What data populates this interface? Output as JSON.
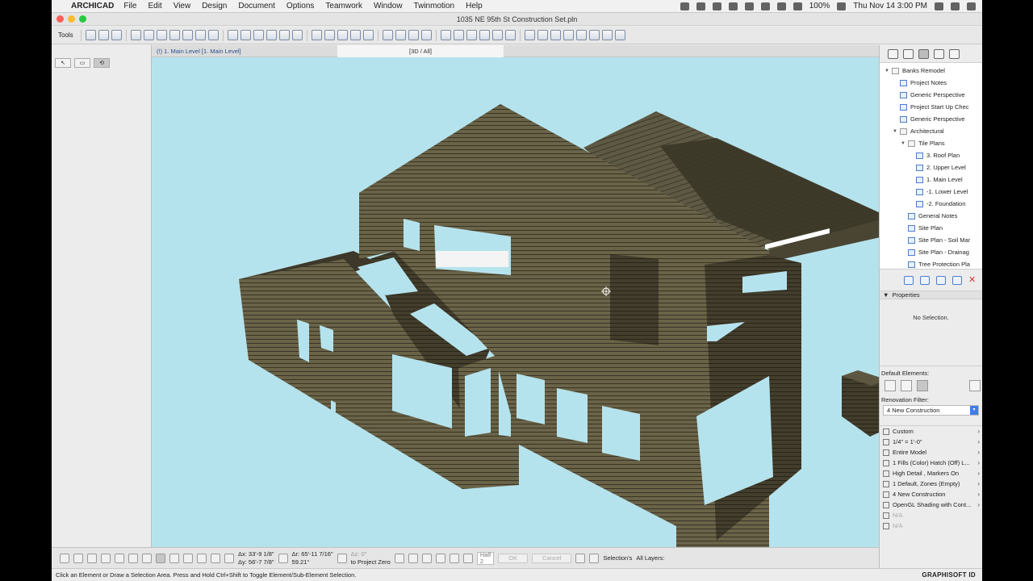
{
  "menubar": {
    "app_name": "ARCHICAD",
    "items": [
      "File",
      "Edit",
      "View",
      "Design",
      "Document",
      "Options",
      "Teamwork",
      "Window",
      "Twinmotion",
      "Help"
    ],
    "battery": "100%",
    "clock": "Thu Nov 14  3:00 PM"
  },
  "window": {
    "title": "1035 NE 95th St Construction Set.pln"
  },
  "toolbar": {
    "tools_label": "Tools"
  },
  "tabs": [
    {
      "label": "(!) 1. Main Level [1. Main Level]"
    },
    {
      "label": "[3D / All]"
    }
  ],
  "navigator": {
    "items": [
      {
        "label": "Banks Remodel",
        "level": 0,
        "disclosure": "▼",
        "folder": true
      },
      {
        "label": "Project Notes",
        "level": 1,
        "disclosure": "",
        "folder": false
      },
      {
        "label": "Generic Perspective",
        "level": 1,
        "disclosure": "",
        "folder": false
      },
      {
        "label": "Project Start Up Chec",
        "level": 1,
        "disclosure": "",
        "folder": false
      },
      {
        "label": "Generic Perspective",
        "level": 1,
        "disclosure": "",
        "folder": false
      },
      {
        "label": "Architectural",
        "level": 1,
        "disclosure": "▼",
        "folder": true
      },
      {
        "label": "Tile Plans",
        "level": 2,
        "disclosure": "▼",
        "folder": true
      },
      {
        "label": "3. Roof Plan",
        "level": 3,
        "disclosure": "",
        "folder": false
      },
      {
        "label": "2. Upper Level",
        "level": 3,
        "disclosure": "",
        "folder": false
      },
      {
        "label": "1. Main Level",
        "level": 3,
        "disclosure": "",
        "folder": false
      },
      {
        "label": "-1. Lower Level",
        "level": 3,
        "disclosure": "",
        "folder": false
      },
      {
        "label": "-2. Foundation",
        "level": 3,
        "disclosure": "",
        "folder": false
      },
      {
        "label": "General Notes",
        "level": 2,
        "disclosure": "",
        "folder": false
      },
      {
        "label": "Site Plan",
        "level": 2,
        "disclosure": "",
        "folder": false
      },
      {
        "label": "Site Plan - Soil Mar",
        "level": 2,
        "disclosure": "",
        "folder": false
      },
      {
        "label": "Site Plan - Drainag",
        "level": 2,
        "disclosure": "",
        "folder": false
      },
      {
        "label": "Tree Protection Pla",
        "level": 2,
        "disclosure": "",
        "folder": false
      }
    ]
  },
  "properties": {
    "header": "Properties",
    "empty_text": "No Selection."
  },
  "defaults": {
    "label": "Default Elements:",
    "renovation_label": "Renovation Filter:",
    "renovation_value": "4 New Construction"
  },
  "quick_options": [
    {
      "label": "Custom",
      "muted": false
    },
    {
      "label": "1/4\"   =    1'-0\"",
      "muted": false
    },
    {
      "label": "Entire Model",
      "muted": false
    },
    {
      "label": "1 Fills (Color) Hatch (Off) L...",
      "muted": false
    },
    {
      "label": "High Detail , Markers On",
      "muted": false
    },
    {
      "label": "1 Default, Zones (Empty)",
      "muted": false
    },
    {
      "label": "4 New Construction",
      "muted": false
    },
    {
      "label": "OpenGL Shading with Cont...",
      "muted": false
    },
    {
      "label": "N/A",
      "muted": true
    },
    {
      "label": "N/A",
      "muted": true
    }
  ],
  "infobar": {
    "dx": "Δx: 33'-9 1/8\"",
    "dy": "Δy: 56'-7 7/8\"",
    "dr": "Δr: 65'-11 7/16\"",
    "angle": "59.21°",
    "dz": "Δz: 0\"",
    "to_project_zero": "to Project Zero",
    "half_label": "Half",
    "half_value": "2",
    "ok": "OK",
    "cancel": "Cancel",
    "selection_label": "Selection's",
    "layers_label": "All Layers:"
  },
  "status": {
    "message": "Click an Element or Draw a Selection Area. Press and Hold Ctrl+Shift to Toggle Element/Sub-Element Selection.",
    "brand": "GRAPHISOFT ID"
  },
  "colors": {
    "viewport_bg": "#b5e3ed",
    "wall": "#6a6348",
    "wall_dark": "#433d2c",
    "roof": "#5a5540"
  }
}
